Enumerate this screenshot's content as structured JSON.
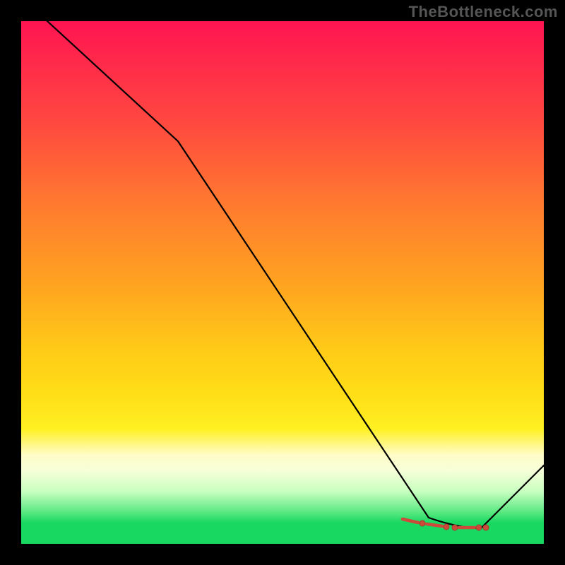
{
  "watermark": "TheBottleneck.com",
  "chart_data": {
    "type": "line",
    "title": "",
    "xlabel": "",
    "ylabel": "",
    "xlim": [
      0,
      100
    ],
    "ylim": [
      0,
      100
    ],
    "grid": false,
    "series": [
      {
        "name": "curve",
        "x": [
          5,
          30,
          78,
          88,
          100
        ],
        "y": [
          100,
          77,
          5,
          3,
          15
        ]
      }
    ],
    "markers": {
      "name": "highlight-cluster",
      "x": [
        72,
        74,
        76,
        78,
        80,
        82,
        84,
        86,
        88
      ],
      "y": [
        4.5,
        4.0,
        3.6,
        3.3,
        3.1,
        3.0,
        3.0,
        3.0,
        3.1
      ]
    },
    "background": {
      "style": "vertical-gradient",
      "stops": [
        "#ff1452",
        "#ffa220",
        "#fff022",
        "#18d862"
      ]
    }
  }
}
